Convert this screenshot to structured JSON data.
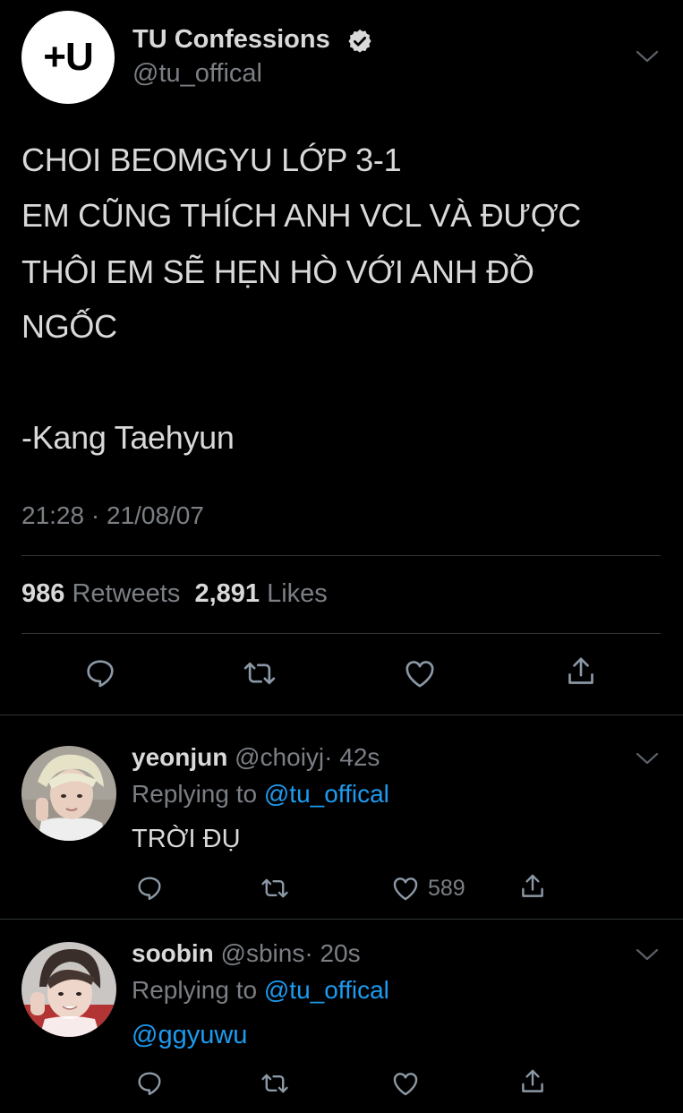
{
  "tweet": {
    "author": {
      "avatar_text": "+U",
      "name": "TU Confessions",
      "handle": "@tu_offical",
      "verified": true
    },
    "lines": [
      "CHOI BEOMGYU LỚP 3-1",
      "EM CŨNG THÍCH ANH VCL VÀ ĐƯỢC",
      "THÔI EM SẼ HẸN HÒ VỚI ANH ĐỒ",
      "NGỐC",
      "-Kang Taehyun"
    ],
    "timestamp": "21:28 · 21/08/07",
    "stats": {
      "retweets": "986",
      "retweets_label": "Retweets",
      "likes": "2,891",
      "likes_label": "Likes"
    },
    "actions": [
      "reply-icon",
      "retweet-icon",
      "like-icon",
      "share-icon"
    ]
  },
  "replies": [
    {
      "name": "yeonjun",
      "handle": "@choiyj",
      "time": "· 42s",
      "replying_prefix": "Replying to",
      "replying_to": "@tu_offical",
      "text": "TRỜI ĐỤ",
      "like_count": "589"
    },
    {
      "name": "soobin",
      "handle": "@sbins",
      "time": "· 20s",
      "replying_prefix": "Replying to",
      "replying_to": "@tu_offical",
      "text": "@ggyuwu"
    }
  ],
  "colors": {
    "background": "#000000",
    "text": "#d9d9d9",
    "muted": "#7b7f84",
    "link": "#1d9bf0",
    "divider": "#2f3336"
  }
}
